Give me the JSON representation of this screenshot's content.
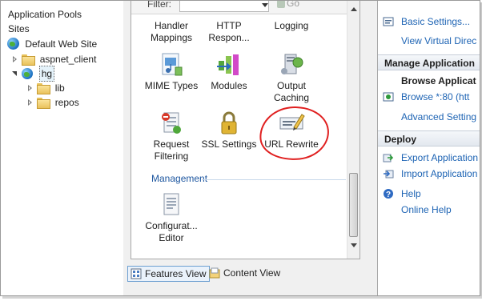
{
  "tree": {
    "items": [
      {
        "label": "Application Pools"
      },
      {
        "label": "Sites"
      },
      {
        "label": "Default Web Site"
      },
      {
        "label": "aspnet_client"
      },
      {
        "label": "hg"
      },
      {
        "label": "lib"
      },
      {
        "label": "repos"
      }
    ]
  },
  "filter": {
    "label": "Filter:",
    "go_label": "Go"
  },
  "features": [
    {
      "label": "Handler\nMappings"
    },
    {
      "label": "HTTP\nRespon..."
    },
    {
      "label": "Logging"
    },
    {
      "label": "MIME Types"
    },
    {
      "label": "Modules"
    },
    {
      "label": "Output\nCaching"
    },
    {
      "label": "Request\nFiltering"
    },
    {
      "label": "SSL Settings"
    },
    {
      "label": "URL Rewrite"
    },
    {
      "label": "Configurat...\nEditor"
    }
  ],
  "management_heading": "Management",
  "views": {
    "features": "Features View",
    "content": "Content View"
  },
  "actions": {
    "basic_settings": "Basic Settings...",
    "view_virtual": "View Virtual Direc",
    "manage_heading": "Manage Application",
    "browse_heading": "Browse Applicat",
    "browse_80": "Browse *:80 (htt",
    "advanced": "Advanced Setting",
    "deploy_heading": "Deploy",
    "export_app": "Export Application",
    "import_app": "Import Application",
    "help": "Help",
    "online_help": "Online Help"
  },
  "colors": {
    "link": "#1e64b4",
    "annotation_circle": "#e02020",
    "management_heading": "#1e57a0"
  },
  "icons": [
    "folder-icon",
    "globe-icon",
    "mime-types-icon",
    "modules-icon",
    "output-caching-icon",
    "request-filtering-icon",
    "ssl-lock-icon",
    "url-rewrite-icon",
    "configuration-editor-icon",
    "features-view-icon",
    "content-view-icon",
    "settings-icon",
    "browse-icon",
    "export-icon",
    "import-icon",
    "help-icon"
  ]
}
